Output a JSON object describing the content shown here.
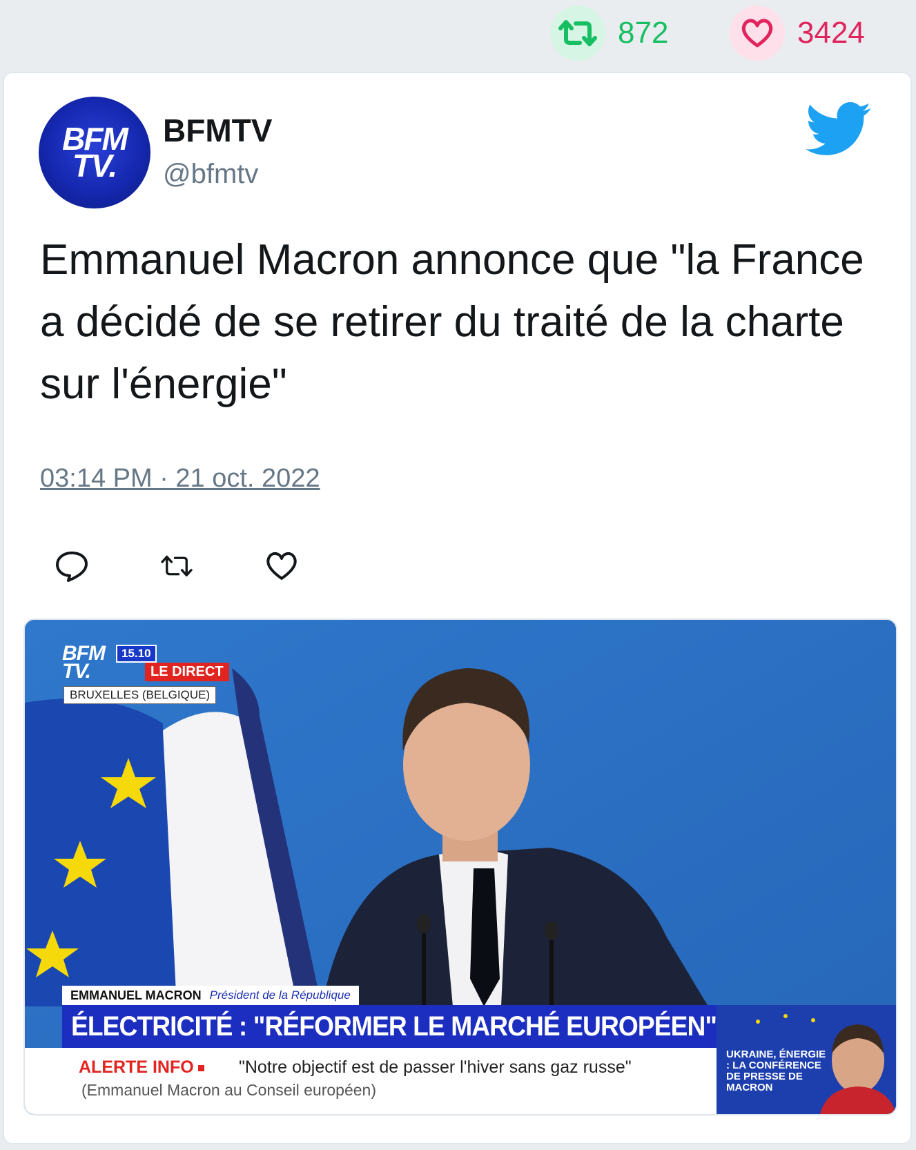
{
  "stats": {
    "retweets": "872",
    "likes": "3424"
  },
  "colors": {
    "retweet": "#17bf63",
    "like": "#e0245e",
    "twitter_blue": "#1da1f2",
    "bfm_blue": "#1c2ec0"
  },
  "author": {
    "name": "BFMTV",
    "handle": "@bfmtv",
    "avatar_text_line1": "BFM",
    "avatar_text_line2": "TV."
  },
  "tweet": {
    "text": "Emmanuel Macron annonce que \"la France a décidé de se retirer du traité de la charte sur l'énergie\"",
    "timestamp": "03:14 PM · 21 oct. 2022"
  },
  "actions": [
    "reply-icon",
    "retweet-icon",
    "like-icon"
  ],
  "media": {
    "logo_line1": "BFM",
    "logo_line2": "TV.",
    "time": "15.10",
    "live_label": "LE DIRECT",
    "location": "BRUXELLES (BELGIQUE)",
    "speaker_name": "EMMANUEL MACRON",
    "speaker_role": "Président de la République",
    "headline": "ÉLECTRICITÉ : \"RÉFORMER LE MARCHÉ EUROPÉEN\"",
    "alert_label": "ALERTE INFO",
    "alert_quote": "\"Notre objectif est de passer l'hiver sans gaz russe\"",
    "alert_source": "(Emmanuel Macron au Conseil européen)",
    "promo_text": "UKRAINE, ÉNERGIE : LA CONFÉRENCE DE PRESSE DE MACRON"
  }
}
